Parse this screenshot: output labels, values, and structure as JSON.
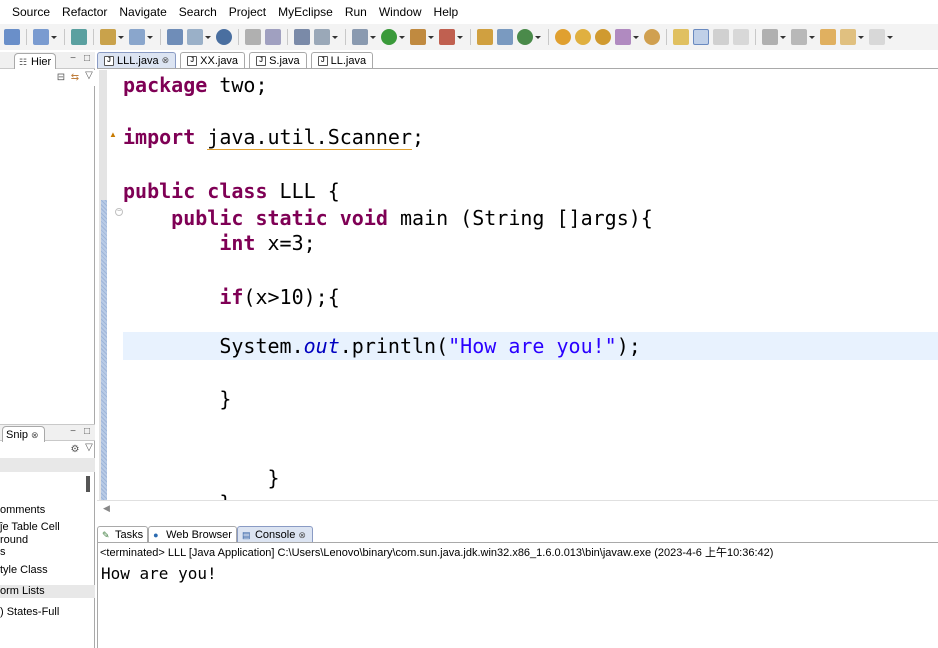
{
  "menu": [
    "Source",
    "Refactor",
    "Navigate",
    "Search",
    "Project",
    "MyEclipse",
    "Run",
    "Window",
    "Help"
  ],
  "left_panel": {
    "hier_tab": "Hier",
    "snip_tab": "Snip",
    "snip_items": [
      "omments",
      "ĵe Table Cell",
      "round",
      "s",
      "tyle Class",
      "orm Lists",
      ") States-Full"
    ]
  },
  "editor": {
    "tabs": [
      {
        "label": "LLL.java",
        "active": true,
        "close": "⊗"
      },
      {
        "label": "XX.java",
        "active": false,
        "close": ""
      },
      {
        "label": "S.java",
        "active": false,
        "close": ""
      },
      {
        "label": "LL.java",
        "active": false,
        "close": ""
      }
    ],
    "code": {
      "l1_kw": "package",
      "l1_rest": " two;",
      "l2_kw": "import",
      "l2_rest": "java.util.Scanner",
      "l2_end": ";",
      "l3_kw1": "public",
      "l3_kw2": "class",
      "l3_rest": " LLL {",
      "l4_kw1": "public",
      "l4_kw2": "static",
      "l4_kw3": "void",
      "l4_rest": " main (String []args){",
      "l5_kw": "int",
      "l5_rest": " x=3;",
      "l6_kw": "if",
      "l6_rest": "(x>10);{",
      "l7_a": "System.",
      "l7_fld": "out",
      "l7_b": ".println(",
      "l7_str": "\"How are you!\"",
      "l7_c": ");",
      "l8": "}",
      "l9": "}",
      "l10": "}"
    }
  },
  "console": {
    "tabs": [
      {
        "label": "Tasks",
        "active": false
      },
      {
        "label": "Web Browser",
        "active": false
      },
      {
        "label": "Console",
        "active": true
      }
    ],
    "status": "<terminated> LLL [Java Application] C:\\Users\\Lenovo\\binary\\com.sun.java.jdk.win32.x86_1.6.0.013\\bin\\javaw.exe (2023-4-6 上午10:36:42)",
    "output": "How are you!"
  },
  "colors": {
    "keyword": "#7f0055",
    "string": "#2a00ff",
    "field": "#0000c0",
    "highlight": "#e8f2fe"
  }
}
